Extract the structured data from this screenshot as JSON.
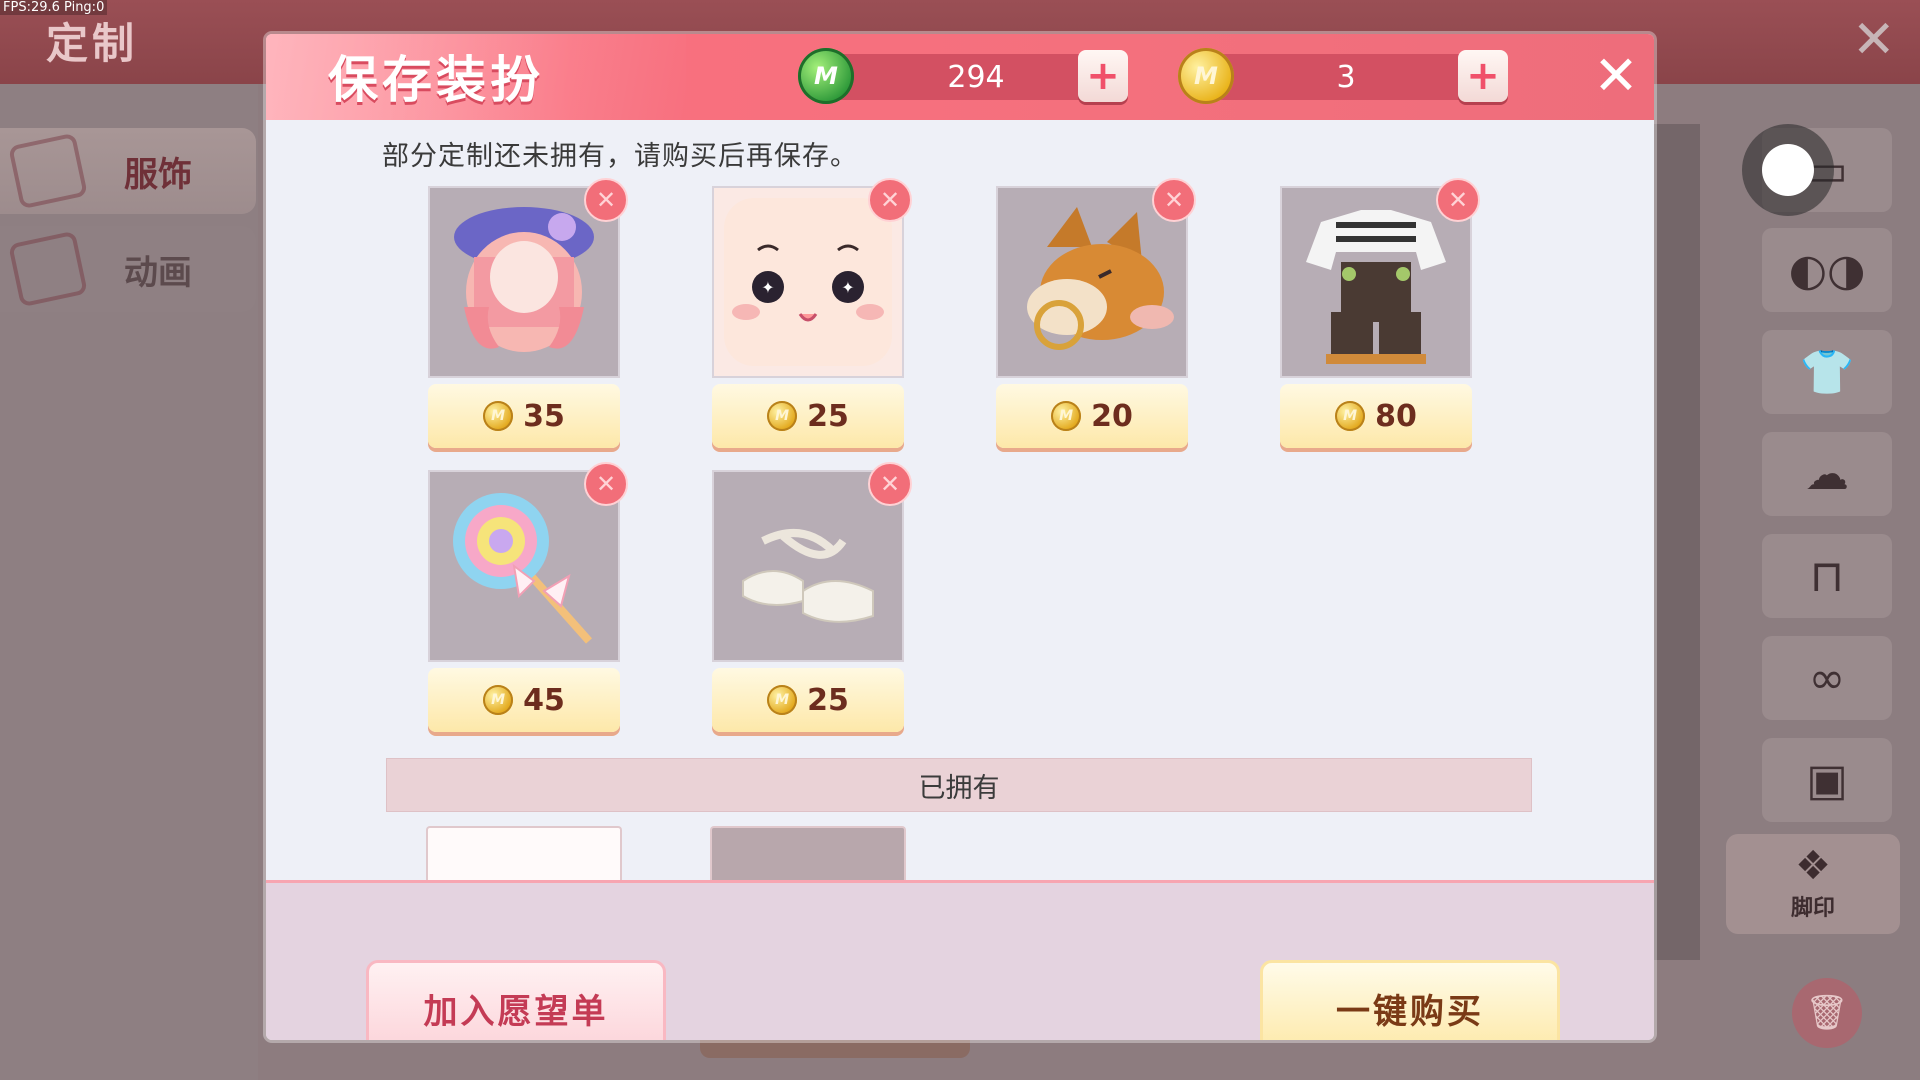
{
  "debug": {
    "fps_text": "FPS:29.6  Ping:0"
  },
  "background": {
    "title": "定制",
    "left_tabs": [
      {
        "label": "服饰"
      },
      {
        "label": "动画"
      }
    ],
    "right_slots": [
      {
        "icon": "mask-icon"
      },
      {
        "icon": "shirt-icon"
      },
      {
        "icon": "hair-icon"
      },
      {
        "icon": "pants-icon"
      },
      {
        "icon": "shoes-icon"
      },
      {
        "icon": "backpack-icon"
      }
    ],
    "footprint_label": "脚印"
  },
  "dialog": {
    "title": "保存装扮",
    "currency_green": {
      "icon": "gem-icon",
      "value": "294"
    },
    "currency_gold": {
      "icon": "m-coin-icon",
      "value": "3"
    },
    "notice": "部分定制还未拥有，请购买后再保存。",
    "unowned_items": [
      {
        "name": "hair",
        "icon": "hair-icon",
        "price": "35"
      },
      {
        "name": "face",
        "icon": "face-icon",
        "price": "25"
      },
      {
        "name": "dog-head",
        "icon": "dog-icon",
        "price": "20"
      },
      {
        "name": "overalls",
        "icon": "overalls-icon",
        "price": "80"
      },
      {
        "name": "lollipop",
        "icon": "lollipop-icon",
        "price": "45"
      },
      {
        "name": "shoes",
        "icon": "shoes-icon",
        "price": "25"
      }
    ],
    "owned_label": "已拥有",
    "buttons": {
      "wishlist": "加入愿望单",
      "buy_all": "一键购买"
    }
  }
}
